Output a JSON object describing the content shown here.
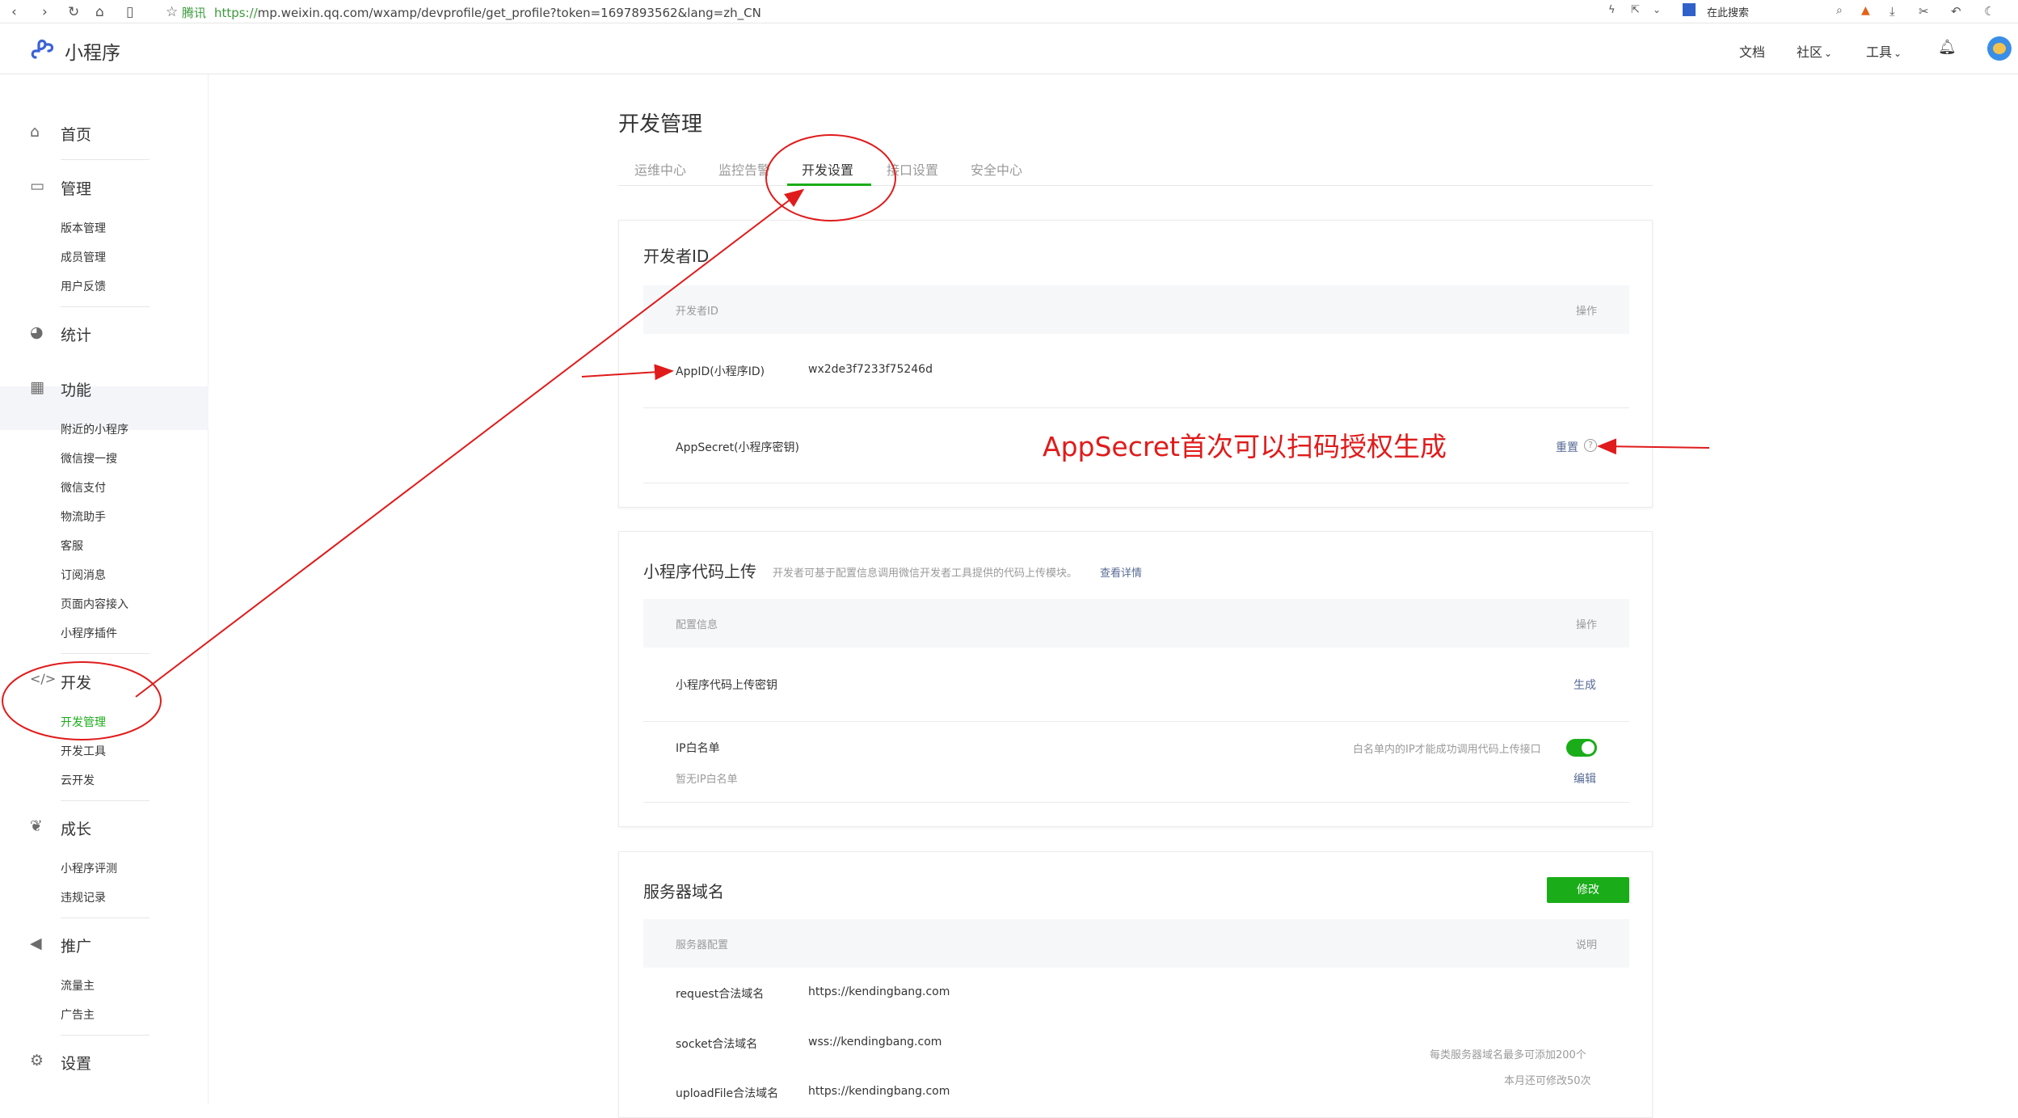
{
  "browser": {
    "url_site": "腾讯",
    "url_https": "https://",
    "url_rest": "mp.weixin.qq.com/wxamp/devprofile/get_profile?token=1697893562&lang=zh_CN",
    "search_placeholder": "在此搜索"
  },
  "header": {
    "brand": "小程序",
    "nav": [
      "文档",
      "社区",
      "工具"
    ],
    "colors": {
      "brand_accent": "#3a62d8"
    }
  },
  "sidebar": {
    "home": "首页",
    "manage": {
      "title": "管理",
      "items": [
        "版本管理",
        "成员管理",
        "用户反馈"
      ]
    },
    "stats": "统计",
    "features": {
      "title": "功能",
      "items": [
        "附近的小程序",
        "微信搜一搜",
        "微信支付",
        "物流助手",
        "客服",
        "订阅消息",
        "页面内容接入",
        "小程序插件"
      ]
    },
    "dev": {
      "title": "开发",
      "items": [
        "开发管理",
        "开发工具",
        "云开发"
      ]
    },
    "growth": {
      "title": "成长",
      "items": [
        "小程序评测",
        "违规记录"
      ]
    },
    "promo": {
      "title": "推广",
      "items": [
        "流量主",
        "广告主"
      ]
    },
    "settings": "设置"
  },
  "main": {
    "title": "开发管理",
    "tabs": [
      "运维中心",
      "监控告警",
      "开发设置",
      "接口设置",
      "安全中心"
    ],
    "dev_id": {
      "title": "开发者ID",
      "head_left": "开发者ID",
      "head_right": "操作",
      "appid_label": "AppID(小程序ID)",
      "appid_value": "wx2de3f7233f75246d",
      "secret_label": "AppSecret(小程序密钥)",
      "secret_action": "重置"
    },
    "upload": {
      "title": "小程序代码上传",
      "desc": "开发者可基于配置信息调用微信开发者工具提供的代码上传模块。",
      "desc_link": "查看详情",
      "head_left": "配置信息",
      "head_right": "操作",
      "key_label": "小程序代码上传密钥",
      "key_action": "生成",
      "ip_label": "IP白名单",
      "ip_empty": "暂无IP白名单",
      "ip_hint": "白名单内的IP才能成功调用代码上传接口",
      "ip_action": "编辑"
    },
    "server": {
      "title": "服务器域名",
      "modify": "修改",
      "head_left": "服务器配置",
      "head_right": "说明",
      "rows": [
        {
          "label": "request合法域名",
          "value": "https://kendingbang.com"
        },
        {
          "label": "socket合法域名",
          "value": "wss://kendingbang.com"
        },
        {
          "label": "uploadFile合法域名",
          "value": "https://kendingbang.com"
        }
      ],
      "note1": "每类服务器域名最多可添加200个",
      "note2": "本月还可修改50次"
    }
  },
  "annotation": {
    "text": "AppSecret首次可以扫码授权生成",
    "color": "#e01b1b"
  }
}
